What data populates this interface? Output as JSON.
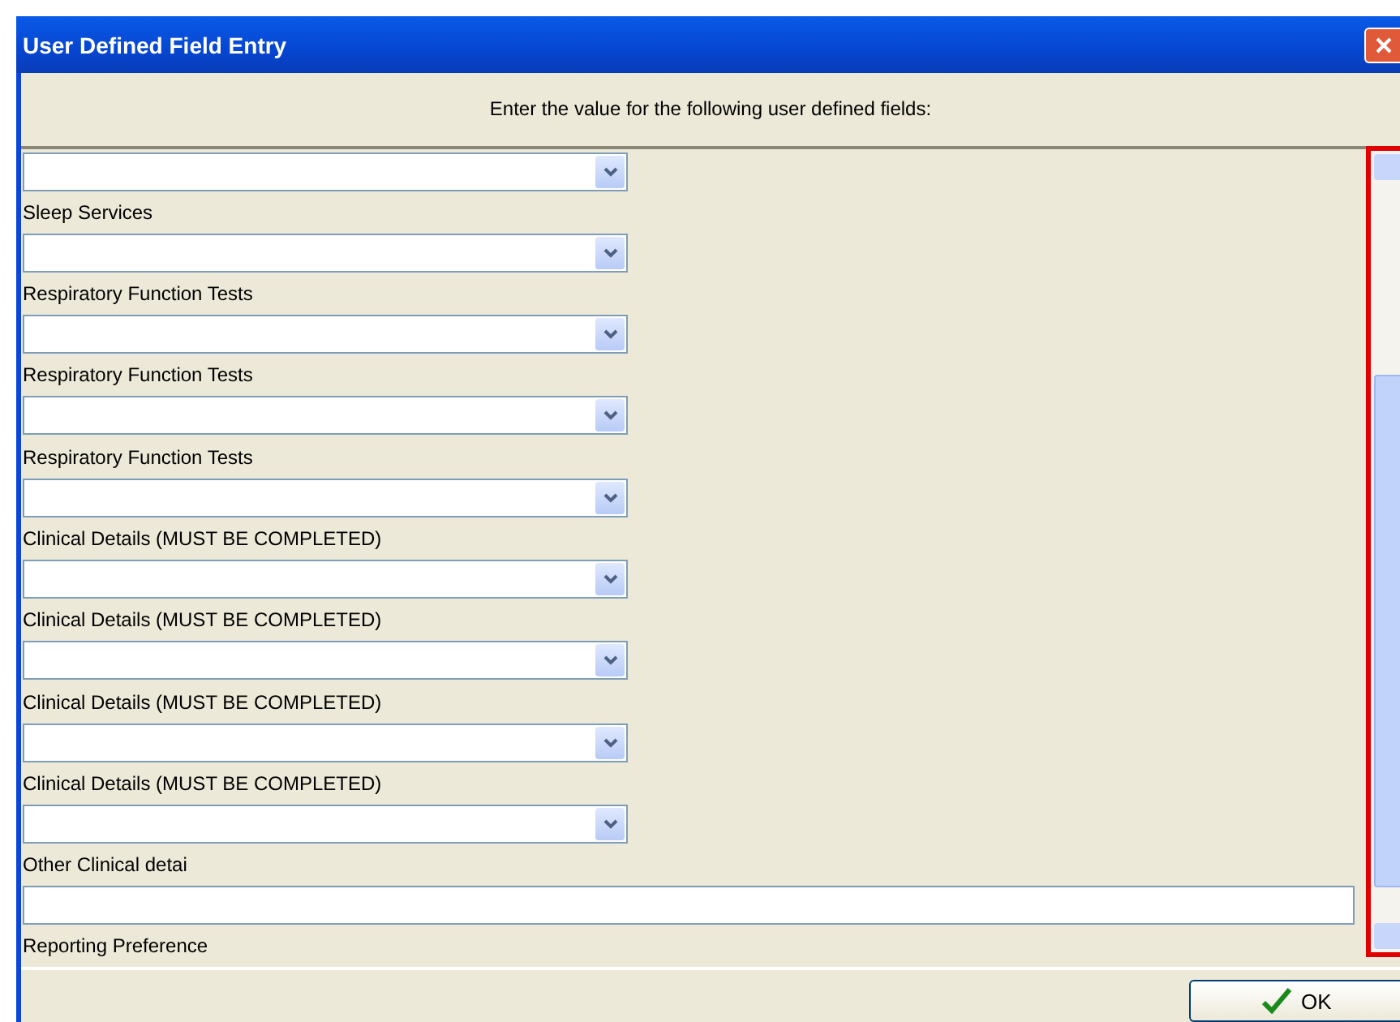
{
  "window": {
    "title": "User Defined Field Entry"
  },
  "instruction": "Enter the value for the following user defined fields:",
  "fields": [
    {
      "kind": "combo"
    },
    {
      "kind": "combo",
      "label": "Sleep Services"
    },
    {
      "kind": "combo",
      "label": "Respiratory Function Tests"
    },
    {
      "kind": "combo",
      "label": "Respiratory Function Tests"
    },
    {
      "kind": "combo",
      "label": "Respiratory Function Tests"
    },
    {
      "kind": "combo",
      "label": "Clinical Details (MUST BE COMPLETED)"
    },
    {
      "kind": "combo",
      "label": "Clinical Details (MUST BE COMPLETED)"
    },
    {
      "kind": "combo",
      "label": "Clinical Details (MUST BE COMPLETED)"
    },
    {
      "kind": "combo",
      "label": "Clinical Details (MUST BE COMPLETED)"
    },
    {
      "kind": "text",
      "label": "Other Clinical detai"
    },
    {
      "kind": "heading",
      "label": "Reporting Preference"
    }
  ],
  "buttons": [
    {
      "label": "OK"
    }
  ]
}
